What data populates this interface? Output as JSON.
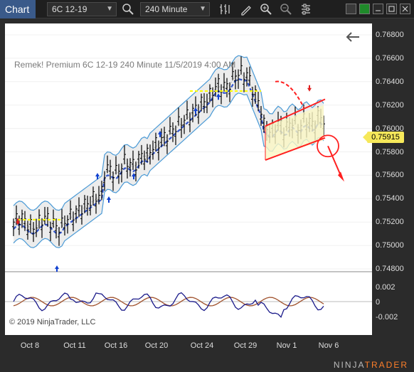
{
  "toolbar": {
    "title": "Chart",
    "instrument": "6C 12-19",
    "interval": "240 Minute"
  },
  "chart": {
    "watermark": "Remek!  Premium  6C 12-19  240 Minute  11/5/2019 4:00 AM",
    "copyright": "© 2019 NinjaTrader, LLC",
    "brand_prefix": "NINJA",
    "brand_suffix": "TRADER",
    "current_price": "0.75915",
    "price_axis": [
      "0.76800",
      "0.76600",
      "0.76400",
      "0.76200",
      "0.76000",
      "0.75800",
      "0.75600",
      "0.75400",
      "0.75200",
      "0.75000",
      "0.74800"
    ],
    "osc_axis": [
      "0.002",
      "0",
      "-0.002"
    ],
    "date_axis": [
      "Oct 8",
      "Oct 11",
      "Oct 16",
      "Oct 20",
      "Oct 24",
      "Oct 29",
      "Nov 1",
      "Nov 6"
    ],
    "colors": {
      "accent": "#3a5a8a",
      "band": "#4a9ad6",
      "ma": "#3355cc",
      "channel": "#ff2020",
      "signal_up": "#1040d0",
      "signal_down": "#e02020",
      "highlight": "#ffff00",
      "osc_fast": "#1a1a8a",
      "osc_slow": "#a0522d",
      "price_tag": "#f6e85a"
    },
    "icons": [
      "magnifier-icon",
      "bar-style-icon",
      "draw-tool-icon",
      "zoom-in-icon",
      "zoom-out-icon",
      "properties-icon",
      "back-arrow-icon"
    ]
  }
}
